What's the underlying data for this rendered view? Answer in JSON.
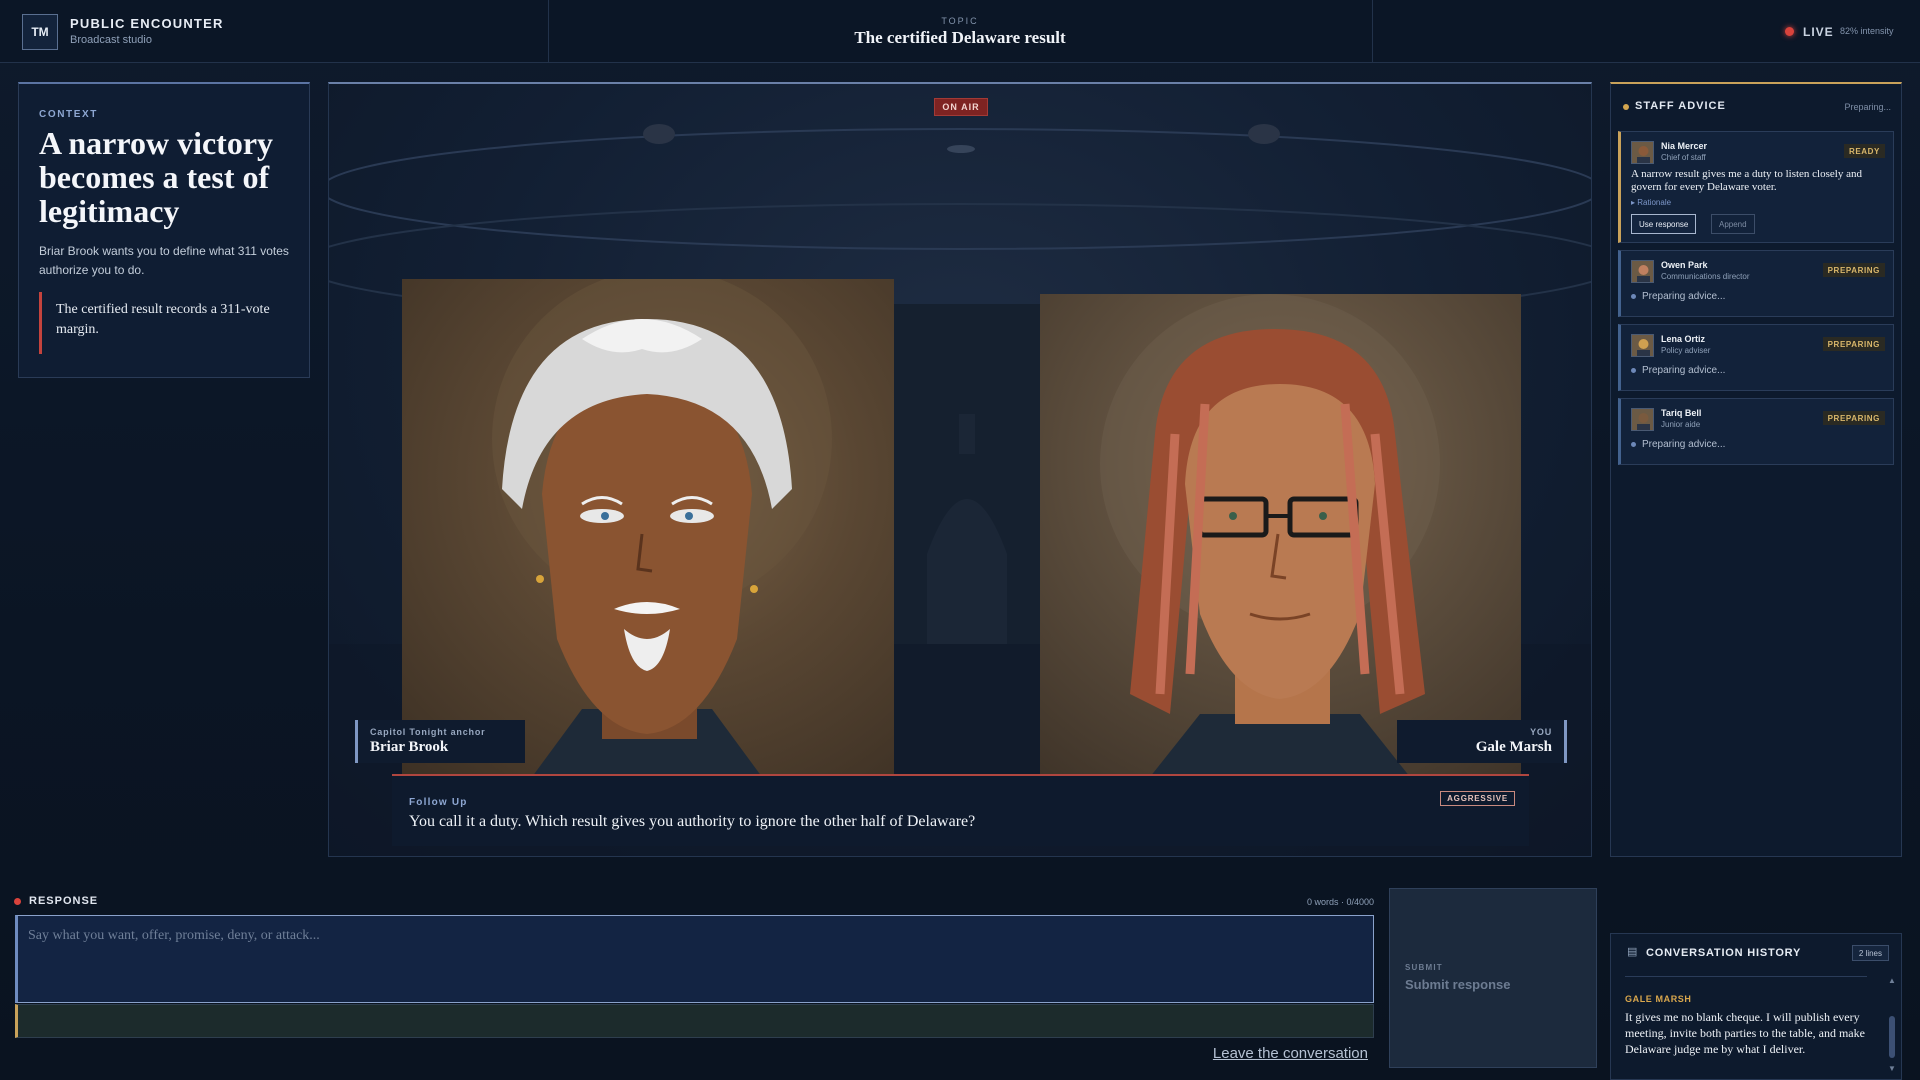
{
  "brand": {
    "badge": "TM",
    "title": "PUBLIC ENCOUNTER",
    "subtitle": "Broadcast studio"
  },
  "topic": {
    "label": "TOPIC",
    "title": "The certified Delaware result"
  },
  "live": {
    "label": "LIVE",
    "intensity": "82% intensity",
    "color": "#d9433c"
  },
  "context": {
    "label": "CONTEXT",
    "headline": "A narrow victory becomes a test of legitimacy",
    "body": "Briar Brook wants you to define what 311 votes authorize you to do.",
    "quote": "The certified result records a 311-vote margin."
  },
  "stage": {
    "on_air": "ON AIR",
    "host": {
      "role": "Capitol Tonight anchor",
      "name": "Briar Brook"
    },
    "player": {
      "role": "YOU",
      "name": "Gale Marsh"
    },
    "question": {
      "label": "Follow Up",
      "text": "You call it a duty. Which result gives you authority to ignore the other half of Delaware?",
      "tone": "AGGRESSIVE"
    }
  },
  "staff": {
    "title": "STAFF ADVICE",
    "status": "Preparing...",
    "advisors": [
      {
        "name": "Nia Mercer",
        "role": "Chief of staff",
        "badge": "READY",
        "text": "A narrow result gives me a duty to listen closely and govern for every Delaware voter.",
        "rationale": "▸ Rationale",
        "use_label": "Use response",
        "append_label": "Append"
      },
      {
        "name": "Owen Park",
        "role": "Communications director",
        "badge": "PREPARING",
        "text": "Preparing advice..."
      },
      {
        "name": "Lena Ortiz",
        "role": "Policy adviser",
        "badge": "PREPARING",
        "text": "Preparing advice..."
      },
      {
        "name": "Tariq Bell",
        "role": "Junior aide",
        "badge": "PREPARING",
        "text": "Preparing advice..."
      }
    ]
  },
  "response": {
    "label": "RESPONSE",
    "count": "0 words · 0/4000",
    "placeholder": "Say what you want, offer, promise, deny, or attack...",
    "value": "",
    "leave": "Leave the conversation",
    "submit_label": "SUBMIT",
    "submit_text": "Submit response"
  },
  "history": {
    "title": "CONVERSATION HISTORY",
    "badge": "2 lines",
    "entries": [
      {
        "speaker": "GALE MARSH",
        "text": "It gives me no blank cheque. I will publish every meeting, invite both parties to the table, and make Delaware judge me by what I deliver."
      }
    ]
  },
  "icons": {
    "history": "document-icon",
    "scroll_up": "chevron-up-icon",
    "scroll_down": "chevron-down-icon"
  },
  "colors": {
    "accent": "#c9a25a",
    "alert": "#c4433d",
    "link": "#8ea7d2"
  }
}
